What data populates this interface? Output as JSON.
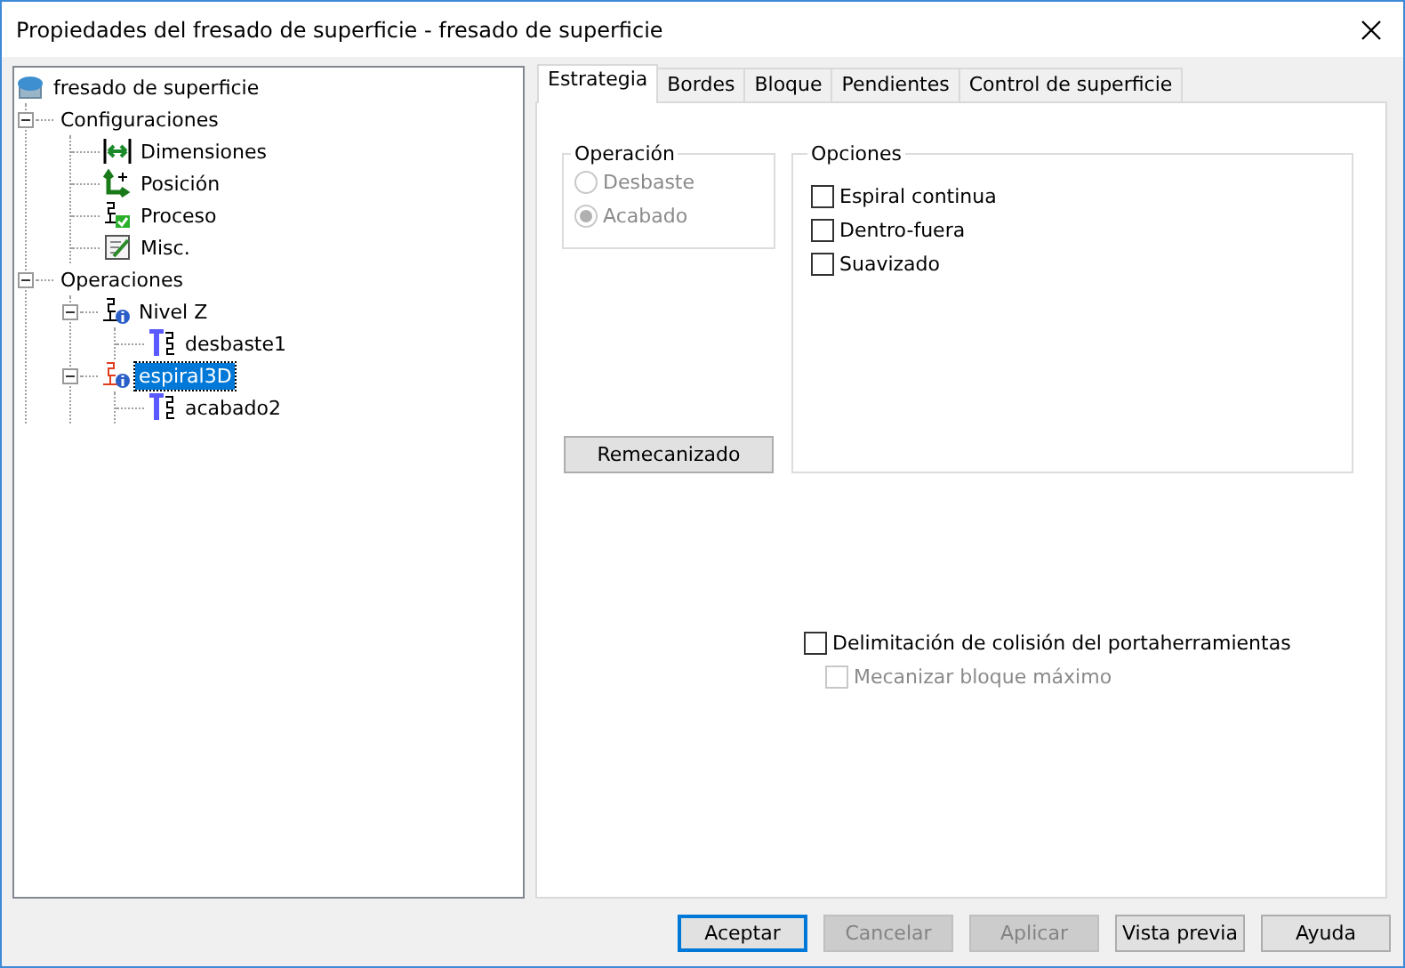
{
  "window": {
    "title": "Propiedades del fresado de superficie - fresado de superficie"
  },
  "tree": [
    {
      "label": "fresado de superficie",
      "kind": "root",
      "selected": false,
      "children": [
        {
          "label": "Configuraciones",
          "selected": false,
          "expanded": true,
          "children": [
            {
              "label": "Dimensiones",
              "kind": "dimensions",
              "selected": false
            },
            {
              "label": "Posición",
              "kind": "position",
              "selected": false
            },
            {
              "label": "Proceso",
              "kind": "process",
              "selected": false
            },
            {
              "label": "Misc.",
              "kind": "misc",
              "selected": false
            }
          ]
        },
        {
          "label": "Operaciones",
          "selected": false,
          "expanded": true,
          "children": [
            {
              "label": "Nivel Z",
              "kind": "operation",
              "color": "#000000",
              "selected": false,
              "expanded": true,
              "children": [
                {
                  "label": "desbaste1",
                  "kind": "tool",
                  "selected": false
                }
              ]
            },
            {
              "label": "espiral3D",
              "kind": "operation",
              "color": "#e03c1e",
              "selected": true,
              "expanded": true,
              "children": [
                {
                  "label": "acabado2",
                  "kind": "tool",
                  "selected": false
                }
              ]
            }
          ]
        }
      ]
    }
  ],
  "tabs": [
    {
      "label": "Estrategia",
      "selected": true
    },
    {
      "label": "Bordes",
      "selected": false
    },
    {
      "label": "Bloque",
      "selected": false
    },
    {
      "label": "Pendientes",
      "selected": false
    },
    {
      "label": "Control de superficie",
      "selected": false
    }
  ],
  "operation_group": {
    "title": "Operación",
    "options": [
      {
        "label": "Desbaste",
        "selected": false,
        "disabled": true
      },
      {
        "label": "Acabado",
        "selected": true,
        "disabled": true
      }
    ]
  },
  "options_group": {
    "title": "Opciones",
    "checkboxes": [
      {
        "label": "Espiral continua",
        "checked": false
      },
      {
        "label": "Dentro-fuera",
        "checked": false
      },
      {
        "label": "Suavizado",
        "checked": false
      }
    ]
  },
  "remachining_button": "Remecanizado",
  "holder_checkboxes": [
    {
      "label": "Delimitación de colisión del portaherramientas",
      "checked": false,
      "disabled": false
    },
    {
      "label": "Mecanizar bloque máximo",
      "checked": false,
      "disabled": true
    }
  ],
  "buttons": [
    {
      "label": "Aceptar",
      "disabled": false,
      "focused": true
    },
    {
      "label": "Cancelar",
      "disabled": true,
      "focused": false
    },
    {
      "label": "Aplicar",
      "disabled": true,
      "focused": false
    },
    {
      "label": "Vista previa",
      "disabled": false,
      "focused": false
    },
    {
      "label": "Ayuda",
      "disabled": false,
      "focused": false
    }
  ]
}
